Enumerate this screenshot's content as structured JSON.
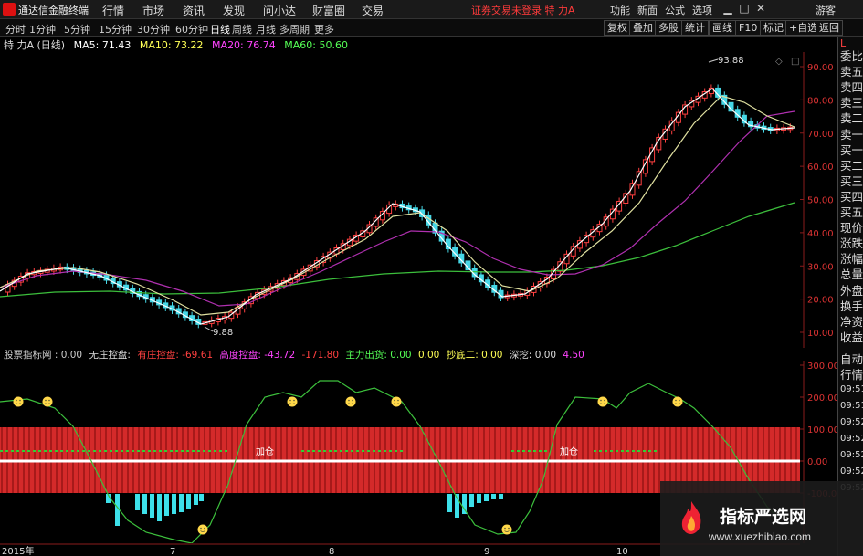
{
  "titlebar": {
    "app_name": "通达信金融终端",
    "menus": [
      "行情",
      "市场",
      "资讯",
      "发现",
      "问小达",
      "财富圈",
      "交易"
    ],
    "notice": "证券交易未登录  特 力A",
    "right_menus": [
      "功能",
      "新面",
      "公式",
      "选项"
    ],
    "guest": "游客"
  },
  "toolbar": {
    "periods": [
      "分时",
      "1分钟",
      "5分钟",
      "15分钟",
      "30分钟",
      "60分钟",
      "日线",
      "周线",
      "月线",
      "多周期",
      "更多"
    ],
    "buttons": [
      "复权",
      "叠加",
      "多股",
      "统计",
      "画线",
      "F10",
      "标记",
      "+自选",
      "返回"
    ]
  },
  "ma_header": {
    "stock": "特 力A (日线)",
    "ma5": "MA5: 71.43",
    "ma10": "MA10: 73.22",
    "ma20": "MA20: 76.74",
    "ma60": "MA60: 50.60",
    "colors": {
      "ma5": "#ffffff",
      "ma10": "#ffff55",
      "ma20": "#ff44ff",
      "ma60": "#55ff55"
    }
  },
  "price_chart": {
    "high_label": "93.88",
    "low_label": "9.88",
    "y_ticks": [
      "90.00",
      "80.00",
      "70.00",
      "60.00",
      "50.00",
      "40.00",
      "30.00",
      "20.00",
      "10.00"
    ],
    "y_ticks_values": [
      90,
      80,
      70,
      60,
      50,
      40,
      30,
      20,
      10
    ]
  },
  "indicator_header": {
    "name": "股票指标网 : 0.00",
    "items": [
      {
        "text": "无庄控盘: ",
        "color": "#dddddd"
      },
      {
        "text": "有庄控盘: -69.61",
        "color": "#ff4040"
      },
      {
        "text": "高度控盘: -43.72",
        "color": "#ff44ff"
      },
      {
        "text": "-171.80",
        "color": "#ff4040"
      },
      {
        "text": "主力出货: 0.00",
        "color": "#55ff55"
      },
      {
        "text": "0.00",
        "color": "#ffff55"
      },
      {
        "text": "抄底二: 0.00",
        "color": "#ffff55"
      },
      {
        "text": "深挖: 0.00",
        "color": "#dddddd"
      },
      {
        "text": "4.50",
        "color": "#ff44ff"
      }
    ]
  },
  "indicator_chart": {
    "y_ticks": [
      "300.00",
      "200.00",
      "100.00",
      "0.00",
      "-100.00"
    ],
    "y_ticks_values": [
      300,
      200,
      100,
      0,
      -100
    ],
    "signal_labels": [
      "加仓",
      "加仓"
    ]
  },
  "x_axis": {
    "labels": [
      "2015年",
      "7",
      "8",
      "9",
      "10"
    ]
  },
  "right_panel": {
    "items": [
      "委比",
      "卖五",
      "卖四",
      "卖三",
      "卖二",
      "卖一",
      "买一",
      "买二",
      "买三",
      "买四",
      "买五",
      "现价",
      "涨跌",
      "涨幅",
      "总量",
      "外盘",
      "换手",
      "净资",
      "收益"
    ],
    "auto_label": "自动",
    "trade_label": "行情",
    "times": [
      "09:51",
      "09:51",
      "09:52",
      "09:52",
      "09:52",
      "09:52",
      "09:52"
    ]
  },
  "watermark": {
    "title": "指标严选网",
    "url": "www.xuezhibiao.com"
  }
}
